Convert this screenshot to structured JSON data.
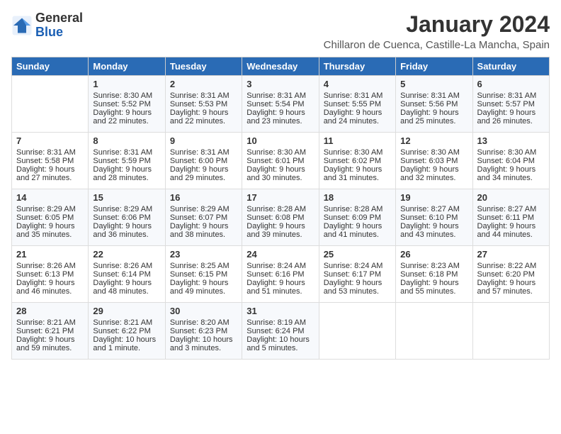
{
  "header": {
    "logo_general": "General",
    "logo_blue": "Blue",
    "month_year": "January 2024",
    "location": "Chillaron de Cuenca, Castille-La Mancha, Spain"
  },
  "weekdays": [
    "Sunday",
    "Monday",
    "Tuesday",
    "Wednesday",
    "Thursday",
    "Friday",
    "Saturday"
  ],
  "weeks": [
    [
      {
        "day": "",
        "content": ""
      },
      {
        "day": "1",
        "sunrise": "Sunrise: 8:30 AM",
        "sunset": "Sunset: 5:52 PM",
        "daylight": "Daylight: 9 hours and 22 minutes."
      },
      {
        "day": "2",
        "sunrise": "Sunrise: 8:31 AM",
        "sunset": "Sunset: 5:53 PM",
        "daylight": "Daylight: 9 hours and 22 minutes."
      },
      {
        "day": "3",
        "sunrise": "Sunrise: 8:31 AM",
        "sunset": "Sunset: 5:54 PM",
        "daylight": "Daylight: 9 hours and 23 minutes."
      },
      {
        "day": "4",
        "sunrise": "Sunrise: 8:31 AM",
        "sunset": "Sunset: 5:55 PM",
        "daylight": "Daylight: 9 hours and 24 minutes."
      },
      {
        "day": "5",
        "sunrise": "Sunrise: 8:31 AM",
        "sunset": "Sunset: 5:56 PM",
        "daylight": "Daylight: 9 hours and 25 minutes."
      },
      {
        "day": "6",
        "sunrise": "Sunrise: 8:31 AM",
        "sunset": "Sunset: 5:57 PM",
        "daylight": "Daylight: 9 hours and 26 minutes."
      }
    ],
    [
      {
        "day": "7",
        "sunrise": "Sunrise: 8:31 AM",
        "sunset": "Sunset: 5:58 PM",
        "daylight": "Daylight: 9 hours and 27 minutes."
      },
      {
        "day": "8",
        "sunrise": "Sunrise: 8:31 AM",
        "sunset": "Sunset: 5:59 PM",
        "daylight": "Daylight: 9 hours and 28 minutes."
      },
      {
        "day": "9",
        "sunrise": "Sunrise: 8:31 AM",
        "sunset": "Sunset: 6:00 PM",
        "daylight": "Daylight: 9 hours and 29 minutes."
      },
      {
        "day": "10",
        "sunrise": "Sunrise: 8:30 AM",
        "sunset": "Sunset: 6:01 PM",
        "daylight": "Daylight: 9 hours and 30 minutes."
      },
      {
        "day": "11",
        "sunrise": "Sunrise: 8:30 AM",
        "sunset": "Sunset: 6:02 PM",
        "daylight": "Daylight: 9 hours and 31 minutes."
      },
      {
        "day": "12",
        "sunrise": "Sunrise: 8:30 AM",
        "sunset": "Sunset: 6:03 PM",
        "daylight": "Daylight: 9 hours and 32 minutes."
      },
      {
        "day": "13",
        "sunrise": "Sunrise: 8:30 AM",
        "sunset": "Sunset: 6:04 PM",
        "daylight": "Daylight: 9 hours and 34 minutes."
      }
    ],
    [
      {
        "day": "14",
        "sunrise": "Sunrise: 8:29 AM",
        "sunset": "Sunset: 6:05 PM",
        "daylight": "Daylight: 9 hours and 35 minutes."
      },
      {
        "day": "15",
        "sunrise": "Sunrise: 8:29 AM",
        "sunset": "Sunset: 6:06 PM",
        "daylight": "Daylight: 9 hours and 36 minutes."
      },
      {
        "day": "16",
        "sunrise": "Sunrise: 8:29 AM",
        "sunset": "Sunset: 6:07 PM",
        "daylight": "Daylight: 9 hours and 38 minutes."
      },
      {
        "day": "17",
        "sunrise": "Sunrise: 8:28 AM",
        "sunset": "Sunset: 6:08 PM",
        "daylight": "Daylight: 9 hours and 39 minutes."
      },
      {
        "day": "18",
        "sunrise": "Sunrise: 8:28 AM",
        "sunset": "Sunset: 6:09 PM",
        "daylight": "Daylight: 9 hours and 41 minutes."
      },
      {
        "day": "19",
        "sunrise": "Sunrise: 8:27 AM",
        "sunset": "Sunset: 6:10 PM",
        "daylight": "Daylight: 9 hours and 43 minutes."
      },
      {
        "day": "20",
        "sunrise": "Sunrise: 8:27 AM",
        "sunset": "Sunset: 6:11 PM",
        "daylight": "Daylight: 9 hours and 44 minutes."
      }
    ],
    [
      {
        "day": "21",
        "sunrise": "Sunrise: 8:26 AM",
        "sunset": "Sunset: 6:13 PM",
        "daylight": "Daylight: 9 hours and 46 minutes."
      },
      {
        "day": "22",
        "sunrise": "Sunrise: 8:26 AM",
        "sunset": "Sunset: 6:14 PM",
        "daylight": "Daylight: 9 hours and 48 minutes."
      },
      {
        "day": "23",
        "sunrise": "Sunrise: 8:25 AM",
        "sunset": "Sunset: 6:15 PM",
        "daylight": "Daylight: 9 hours and 49 minutes."
      },
      {
        "day": "24",
        "sunrise": "Sunrise: 8:24 AM",
        "sunset": "Sunset: 6:16 PM",
        "daylight": "Daylight: 9 hours and 51 minutes."
      },
      {
        "day": "25",
        "sunrise": "Sunrise: 8:24 AM",
        "sunset": "Sunset: 6:17 PM",
        "daylight": "Daylight: 9 hours and 53 minutes."
      },
      {
        "day": "26",
        "sunrise": "Sunrise: 8:23 AM",
        "sunset": "Sunset: 6:18 PM",
        "daylight": "Daylight: 9 hours and 55 minutes."
      },
      {
        "day": "27",
        "sunrise": "Sunrise: 8:22 AM",
        "sunset": "Sunset: 6:20 PM",
        "daylight": "Daylight: 9 hours and 57 minutes."
      }
    ],
    [
      {
        "day": "28",
        "sunrise": "Sunrise: 8:21 AM",
        "sunset": "Sunset: 6:21 PM",
        "daylight": "Daylight: 9 hours and 59 minutes."
      },
      {
        "day": "29",
        "sunrise": "Sunrise: 8:21 AM",
        "sunset": "Sunset: 6:22 PM",
        "daylight": "Daylight: 10 hours and 1 minute."
      },
      {
        "day": "30",
        "sunrise": "Sunrise: 8:20 AM",
        "sunset": "Sunset: 6:23 PM",
        "daylight": "Daylight: 10 hours and 3 minutes."
      },
      {
        "day": "31",
        "sunrise": "Sunrise: 8:19 AM",
        "sunset": "Sunset: 6:24 PM",
        "daylight": "Daylight: 10 hours and 5 minutes."
      },
      {
        "day": "",
        "content": ""
      },
      {
        "day": "",
        "content": ""
      },
      {
        "day": "",
        "content": ""
      }
    ]
  ]
}
